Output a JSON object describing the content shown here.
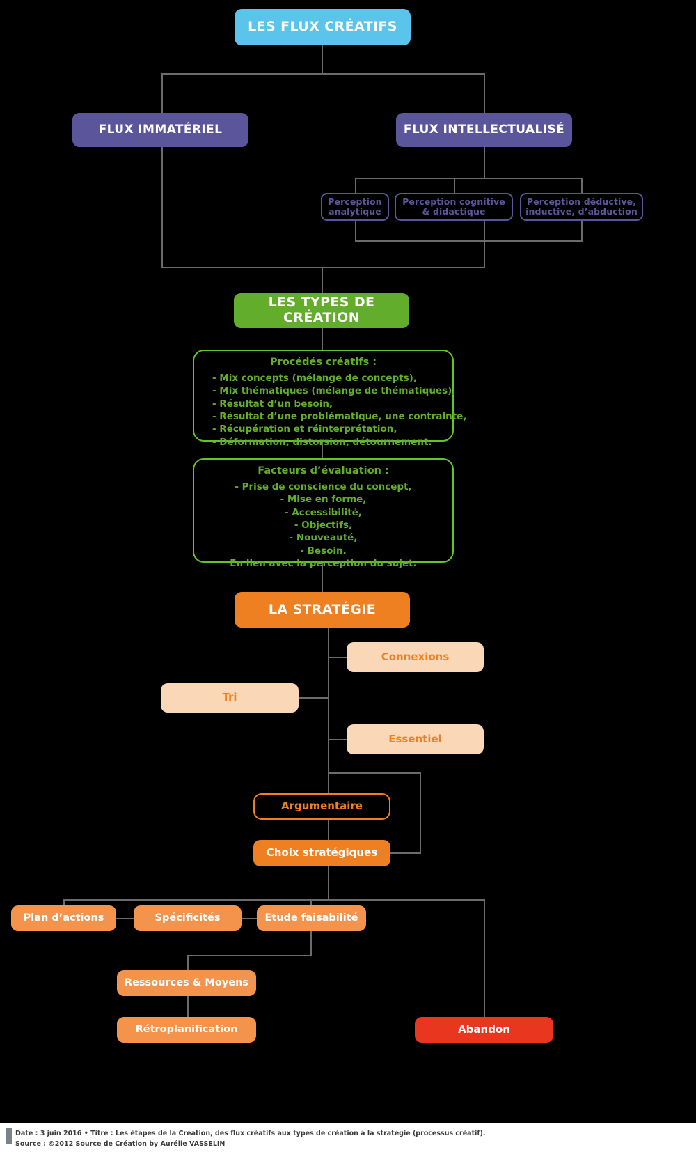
{
  "colors": {
    "background": "#000000",
    "title_blue": "#5bc4ea",
    "flux_purple": "#5b569c",
    "green_fill": "#63ad2d",
    "green_outline": "#63c520",
    "strategy_orange": "#ef8022",
    "pale_orange": "#fad7b6",
    "light_orange": "#f4944c",
    "abandon_red": "#e8361f",
    "connector_gray": "#6b6b6b",
    "footer_bg": "#ffffff"
  },
  "diagram": {
    "title": "LES FLUX CRÉATIFS",
    "flux": {
      "immateriel": "FLUX IMMATÉRIEL",
      "intellectualise": "FLUX INTELLECTUALISÉ"
    },
    "perceptions": [
      {
        "line1": "Perception",
        "line2": "analytique"
      },
      {
        "line1": "Perception cognitive",
        "line2": "& didactique"
      },
      {
        "line1": "Perception déductive,",
        "line2": "inductive, d’abduction"
      }
    ],
    "types_creation": "LES TYPES DE CRÉATION",
    "procedes": {
      "title": "Procédés créatifs :",
      "items": [
        "- Mix concepts (mélange de concepts),",
        "- Mix thématiques (mélange de thématiques),",
        "- Résultat d’un besoin,",
        "- Résultat d’une problématique, une contrainte,",
        "- Récupération et réinterprétation,",
        "- Déformation, distorsion, détournement."
      ]
    },
    "facteurs": {
      "title": "Facteurs d’évaluation :",
      "items": [
        "- Prise de conscience du concept,",
        "- Mise en forme,",
        "- Accessibilité,",
        "- Objectifs,",
        "- Nouveauté,",
        "- Besoin.",
        "En lien avec la perception du sujet."
      ]
    },
    "strategie": "LA STRATÉGIE",
    "strategy_branches": {
      "connexions": "Connexions",
      "tri": "Tri",
      "essentiel": "Essentiel"
    },
    "argumentaire": "Argumentaire",
    "choix_strategiques": "Choix stratégiques",
    "actions_row": [
      "Plan d’actions",
      "Spécificités",
      "Etude faisabilité"
    ],
    "ressources": "Ressources & Moyens",
    "retroplanification": "Rétroplanification",
    "abandon": "Abandon"
  },
  "footer": {
    "line1": "Date : 3 juin 2016 • Titre : Les étapes de la Création, des flux créatifs aux types de création à la stratégie (processus créatif).",
    "line2": "Source : ©2012 Source de Création by Aurélie VASSELIN"
  }
}
